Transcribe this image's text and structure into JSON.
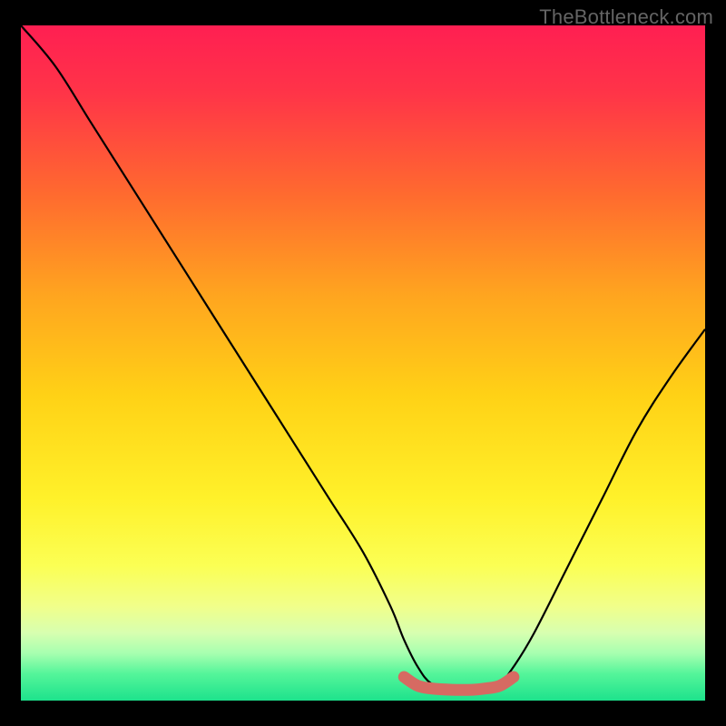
{
  "watermark": "TheBottleneck.com",
  "chart_data": {
    "type": "line",
    "title": "",
    "xlabel": "",
    "ylabel": "",
    "xlim": [
      0,
      100
    ],
    "ylim": [
      0,
      100
    ],
    "series": [
      {
        "name": "bottleneck-curve",
        "x": [
          0,
          5,
          10,
          15,
          20,
          25,
          30,
          35,
          40,
          45,
          50,
          54,
          56,
          58,
          60,
          63,
          66,
          68,
          70,
          72,
          75,
          80,
          85,
          90,
          95,
          100
        ],
        "y": [
          100,
          94,
          86,
          78,
          70,
          62,
          54,
          46,
          38,
          30,
          22,
          14,
          9,
          5,
          2.5,
          1.5,
          1.5,
          1.5,
          2.5,
          5,
          10,
          20,
          30,
          40,
          48,
          55
        ]
      },
      {
        "name": "sweet-spot-marker",
        "x": [
          56,
          58,
          60,
          63,
          66,
          68,
          70,
          72
        ],
        "y": [
          3.5,
          2.2,
          1.8,
          1.6,
          1.6,
          1.8,
          2.2,
          3.5
        ]
      }
    ],
    "background_gradient_stops": [
      {
        "offset": 0.0,
        "color": "#ff1f52"
      },
      {
        "offset": 0.1,
        "color": "#ff3448"
      },
      {
        "offset": 0.25,
        "color": "#ff6a2f"
      },
      {
        "offset": 0.4,
        "color": "#ffa51f"
      },
      {
        "offset": 0.55,
        "color": "#ffd216"
      },
      {
        "offset": 0.7,
        "color": "#fff12a"
      },
      {
        "offset": 0.8,
        "color": "#fbff54"
      },
      {
        "offset": 0.86,
        "color": "#f1ff8a"
      },
      {
        "offset": 0.9,
        "color": "#d7ffb0"
      },
      {
        "offset": 0.93,
        "color": "#a7ffb0"
      },
      {
        "offset": 0.96,
        "color": "#55f59a"
      },
      {
        "offset": 1.0,
        "color": "#1de28c"
      }
    ],
    "colors": {
      "curve": "#000000",
      "marker": "#d66a62",
      "marker_start_dot": "#d66a62"
    }
  }
}
